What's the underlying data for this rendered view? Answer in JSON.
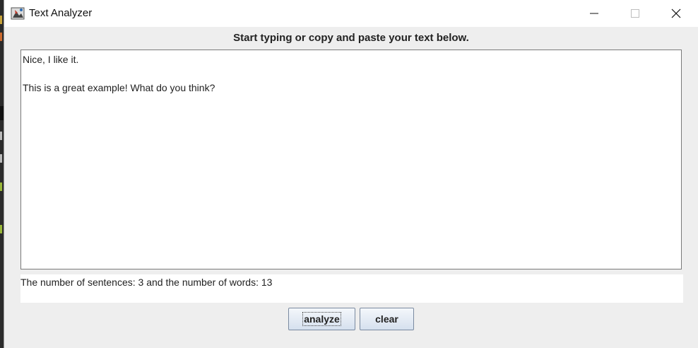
{
  "window": {
    "title": "Text Analyzer",
    "controls": {
      "minimize": "minimize-icon",
      "maximize": "maximize-icon",
      "close": "close-icon"
    }
  },
  "main": {
    "instruction": "Start typing or copy and paste your text below.",
    "text_lines": [
      "Nice, I like it.",
      "",
      "This is a great example! What do you think?"
    ],
    "result": "The number of sentences: 3 and the number of words: 13"
  },
  "buttons": {
    "analyze": "analyze",
    "clear": "clear"
  },
  "colors": {
    "window_bg": "#eeeeee",
    "button_gradient_top": "#f4f7fb",
    "button_gradient_bottom": "#d5e0ee"
  }
}
